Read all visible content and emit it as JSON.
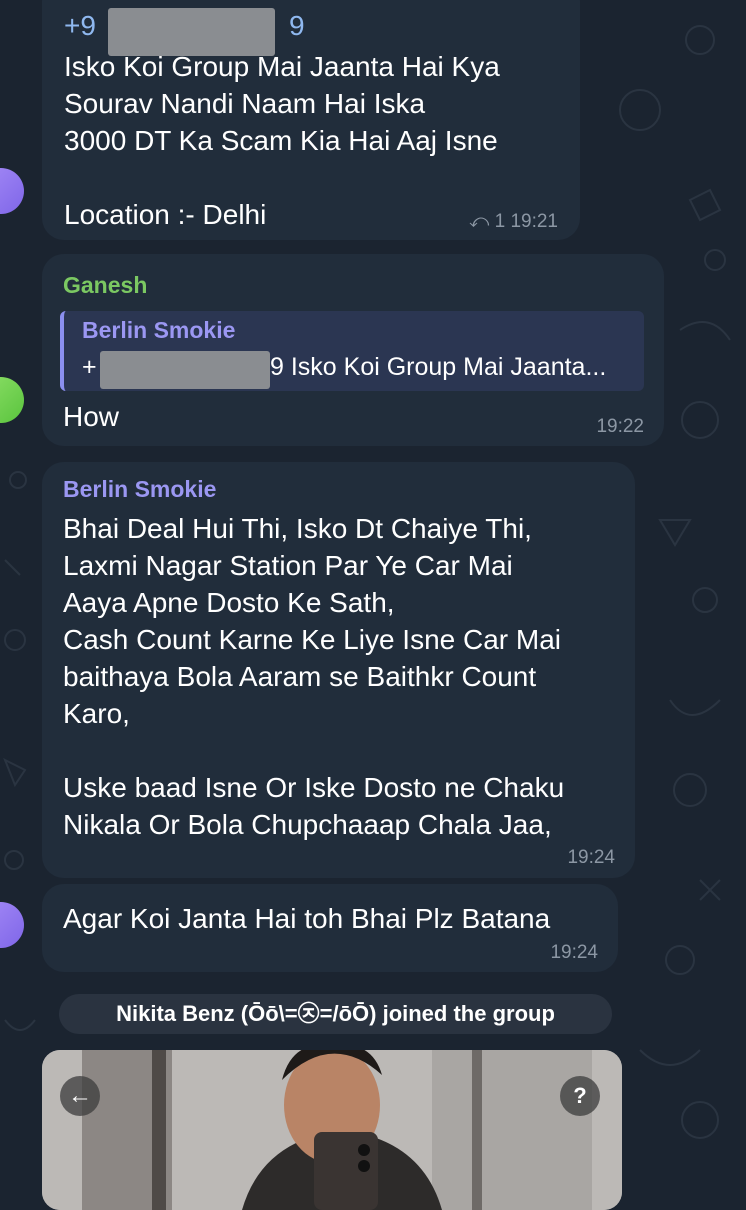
{
  "colors": {
    "background": "#1b2430",
    "bubble": "#212d3b",
    "sender_green": "#7bc862",
    "sender_purple": "#9b97f2",
    "timestamp": "#8c97a4"
  },
  "messages": [
    {
      "phone_prefix": "+9",
      "phone_suffix": "9",
      "text": "Isko Koi Group Mai Jaanta Hai Kya\nSourav Nandi Naam Hai Iska\n3000 DT Ka Scam Kia Hai Aaj Isne\n\nLocation :- Delhi",
      "reply_count": "1",
      "time": "19:21"
    },
    {
      "sender": "Ganesh",
      "reply": {
        "name": "Berlin Smokie",
        "prefix": "+",
        "text": "9 Isko Koi Group Mai Jaanta..."
      },
      "text": "How",
      "time": "19:22"
    },
    {
      "sender": "Berlin Smokie",
      "text": "Bhai Deal Hui Thi, Isko Dt Chaiye Thi,\nLaxmi Nagar Station Par Ye Car Mai\nAaya Apne Dosto Ke Sath,\nCash Count Karne Ke Liye Isne Car Mai\nbaithaya Bola Aaram se Baithkr Count\nKaro,\n\nUske baad Isne Or Iske Dosto ne Chaku\nNikala Or Bola Chupchaaap Chala Jaa,",
      "time": "19:24"
    },
    {
      "text": "Agar Koi Janta Hai toh Bhai Plz Batana",
      "time": "19:24"
    }
  ],
  "service_message": "Nikita Benz (Ōō\\=㉨=/ōŌ) joined the group",
  "photo": {
    "back_icon": "arrow-left-icon",
    "help_icon": "question-icon"
  }
}
